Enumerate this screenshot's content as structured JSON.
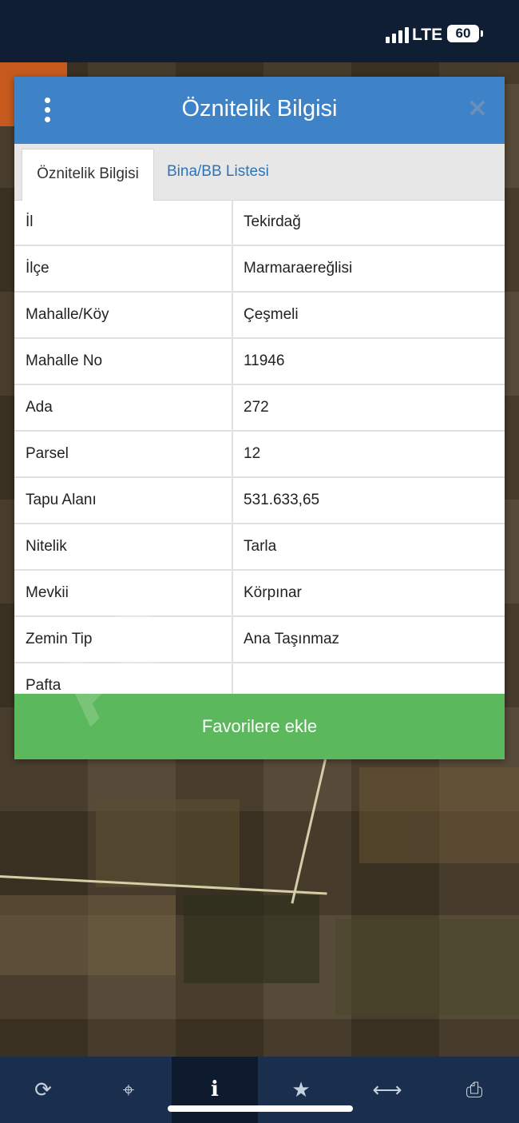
{
  "status_bar": {
    "network": "LTE",
    "battery": "60"
  },
  "dialog": {
    "title": "Öznitelik Bilgisi",
    "tabs": [
      "Öznitelik Bilgisi",
      "Bina/BB Listesi"
    ],
    "rows": [
      {
        "key": "İl",
        "value": "Tekirdağ"
      },
      {
        "key": "İlçe",
        "value": "Marmaraereğlisi"
      },
      {
        "key": "Mahalle/Köy",
        "value": "Çeşmeli"
      },
      {
        "key": "Mahalle No",
        "value": "11946"
      },
      {
        "key": "Ada",
        "value": "272"
      },
      {
        "key": "Parsel",
        "value": "12"
      },
      {
        "key": "Tapu Alanı",
        "value": "531.633,65"
      },
      {
        "key": "Nitelik",
        "value": "Tarla"
      },
      {
        "key": "Mevkii",
        "value": "Körpınar"
      },
      {
        "key": "Zemin Tip",
        "value": "Ana Taşınmaz"
      },
      {
        "key": "Pafta",
        "value": ""
      }
    ],
    "favorite_button": "Favorilere ekle"
  },
  "watermark": "AD",
  "bottom_bar": {
    "items": [
      {
        "icon": "refresh-icon",
        "glyph": "⟳"
      },
      {
        "icon": "locate-icon",
        "glyph": "⌖"
      },
      {
        "icon": "info-icon",
        "glyph": "i"
      },
      {
        "icon": "star-icon",
        "glyph": "★"
      },
      {
        "icon": "measure-icon",
        "glyph": "⟷"
      },
      {
        "icon": "print-icon",
        "glyph": "⎙"
      }
    ]
  }
}
